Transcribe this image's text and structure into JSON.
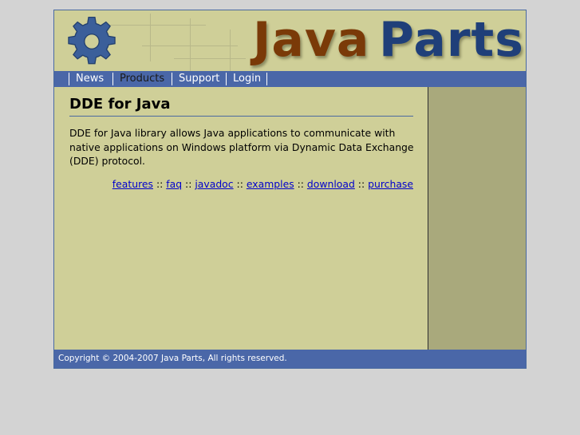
{
  "logo": {
    "word1": "Java",
    "word2": "Parts",
    "icon": "gear-icon",
    "colors": {
      "java": "#7a3a08",
      "parts": "#1f3f79",
      "gear": "#3b5f9a"
    }
  },
  "nav": {
    "items": [
      {
        "label": "News",
        "active": false
      },
      {
        "label": "Products",
        "active": true
      },
      {
        "label": "Support",
        "active": false
      },
      {
        "label": "Login",
        "active": false
      }
    ]
  },
  "main": {
    "title": "DDE for Java",
    "description": "DDE for Java library allows Java applications to communicate with native applications on Windows platform via Dynamic Data Exchange (DDE) protocol.",
    "links": [
      "features",
      "faq",
      "javadoc",
      "examples",
      "download",
      "purchase"
    ],
    "separator": "::"
  },
  "footer": {
    "copyright": "Copyright © 2004-2007 Java Parts, All rights reserved."
  },
  "colors": {
    "page_bg": "#d3d3d3",
    "content_bg": "#cfcf98",
    "sidebar_bg": "#a9a97c",
    "bar_blue": "#4a67a8",
    "link": "#0000cc"
  }
}
